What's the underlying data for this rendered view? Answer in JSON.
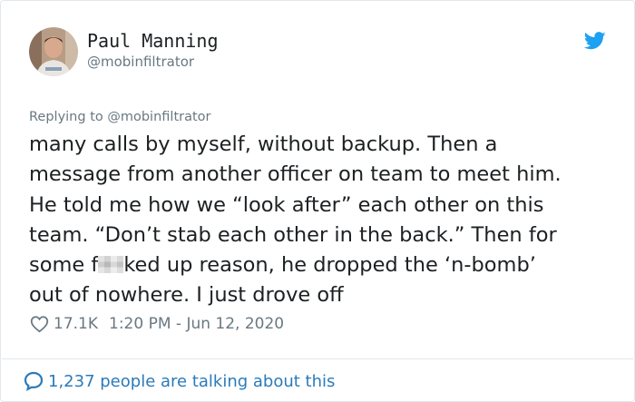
{
  "author": {
    "display_name": "Paul Manning",
    "handle": "@mobinfiltrator",
    "avatar_icon": "user-avatar"
  },
  "reply": {
    "prefix": "Replying to ",
    "mention": "@mobinfiltrator"
  },
  "tweet": {
    "lines": [
      "many calls by myself, without backup. Then a",
      "message from another officer on team to meet him.",
      "He told me how we “look after” each other on this",
      "team. “Don’t stab each other in the back.” Then for",
      "out of nowhere. I just drove off"
    ],
    "line5_before": "some f",
    "line5_after": "ked up reason, he dropped the ‘n-bomb’"
  },
  "stats": {
    "likes": "17.1K",
    "timestamp": "1:20 PM - Jun 12, 2020"
  },
  "footer": {
    "label": "1,237 people are talking about this"
  },
  "colors": {
    "twitter_blue": "#1da1f2",
    "link_blue": "#2b7bb9",
    "secondary_text": "#697882",
    "border": "#e1e8ed"
  }
}
